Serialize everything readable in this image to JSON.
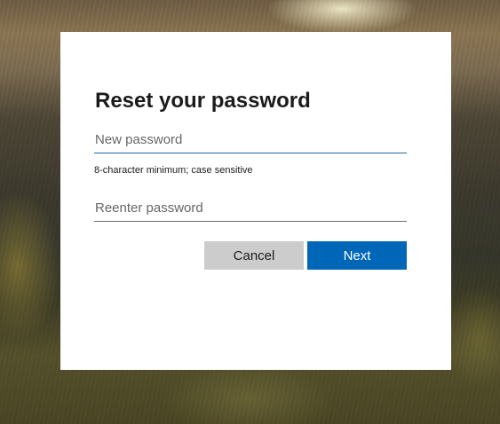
{
  "dialog": {
    "title": "Reset your password",
    "new_password": {
      "value": "",
      "placeholder": "New password"
    },
    "hint": "8-character minimum; case sensitive",
    "reenter_password": {
      "value": "",
      "placeholder": "Reenter password"
    },
    "cancel_label": "Cancel",
    "next_label": "Next"
  },
  "colors": {
    "primary_button": "#0067b8",
    "secondary_button": "#cccccc",
    "focused_underline": "#1d66b2"
  }
}
